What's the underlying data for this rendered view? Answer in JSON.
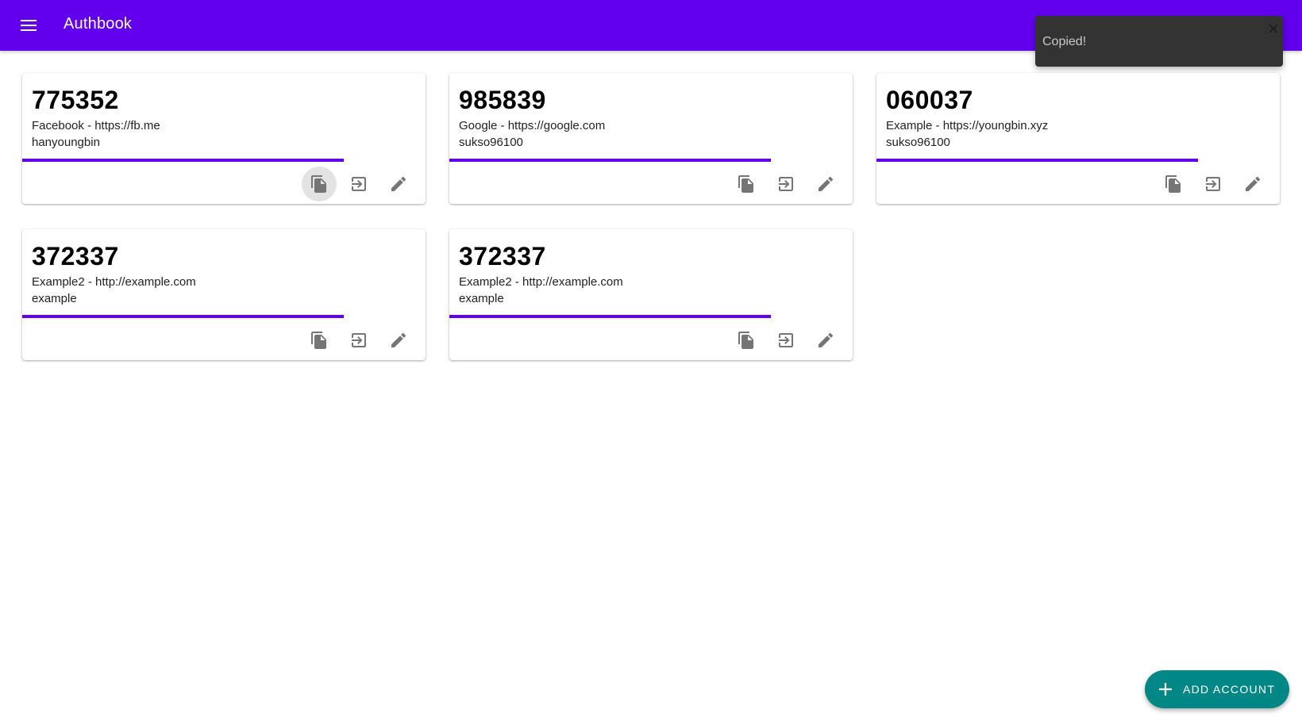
{
  "app": {
    "title": "Authbook",
    "primary_color": "#6200ee",
    "accent_color": "#018786"
  },
  "snackbar": {
    "message": "Copied!"
  },
  "accounts": [
    {
      "code": "775352",
      "service": "Facebook - https://fb.me",
      "user": "hanyoungbin",
      "time_remaining_fraction": 0.8
    },
    {
      "code": "985839",
      "service": "Google - https://google.com",
      "user": "sukso96100",
      "time_remaining_fraction": 0.8
    },
    {
      "code": "060037",
      "service": "Example - https://youngbin.xyz",
      "user": "sukso96100",
      "time_remaining_fraction": 0.8
    },
    {
      "code": "372337",
      "service": "Example2 - http://example.com",
      "user": "example",
      "time_remaining_fraction": 0.8
    },
    {
      "code": "372337",
      "service": "Example2 - http://example.com",
      "user": "example",
      "time_remaining_fraction": 0.8
    }
  ],
  "card_actions": {
    "icons": [
      "copy-icon",
      "open-in-app-icon",
      "edit-icon"
    ]
  },
  "fab": {
    "label": "ADD ACCOUNT",
    "icon": "plus-icon"
  }
}
